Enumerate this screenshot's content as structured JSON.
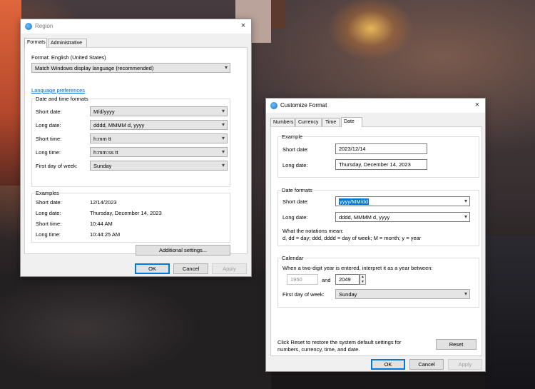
{
  "region": {
    "title": "Region",
    "close": "×",
    "tabs": [
      "Formats",
      "Administrative"
    ],
    "format_label": "Format: English (United States)",
    "format_value": "Match Windows display language (recommended)",
    "language_link": "Language preferences",
    "dt_group": "Date and time formats",
    "short_date": {
      "label": "Short date:",
      "value": "M/d/yyyy"
    },
    "long_date": {
      "label": "Long date:",
      "value": "dddd, MMMM d, yyyy"
    },
    "short_time": {
      "label": "Short time:",
      "value": "h:mm tt"
    },
    "long_time": {
      "label": "Long time:",
      "value": "h:mm:ss tt"
    },
    "first_day": {
      "label": "First day of week:",
      "value": "Sunday"
    },
    "examples_group": "Examples",
    "examples": [
      {
        "label": "Short date:",
        "value": "12/14/2023"
      },
      {
        "label": "Long date:",
        "value": "Thursday, December 14, 2023"
      },
      {
        "label": "Short time:",
        "value": "10:44 AM"
      },
      {
        "label": "Long time:",
        "value": "10:44:25 AM"
      }
    ],
    "additional_btn": "Additional settings...",
    "ok": "OK",
    "cancel": "Cancel",
    "apply": "Apply"
  },
  "customize": {
    "title": "Customize Format",
    "close": "×",
    "tabs": [
      "Numbers",
      "Currency",
      "Time",
      "Date"
    ],
    "example_group": "Example",
    "ex_short_label": "Short date:",
    "ex_short_value": "2023/12/14",
    "ex_long_label": "Long date:",
    "ex_long_value": "Thursday, December 14, 2023",
    "formats_group": "Date formats",
    "short_label": "Short date:",
    "short_value": "yyyy/MM/dd",
    "long_label": "Long date:",
    "long_value": "dddd, MMMM d, yyyy",
    "notations_title": "What the notations mean:",
    "notations_text": "d, dd = day;  ddd, dddd = day of week;  M = month;  y = year",
    "calendar_group": "Calendar",
    "calendar_text": "When a two-digit year is entered, interpret it as a year between:",
    "year_from": "1950",
    "and": "and",
    "year_to": "2049",
    "first_day_label": "First day of week:",
    "first_day_value": "Sunday",
    "reset_text_1": "Click Reset to restore the system default settings for",
    "reset_text_2": "numbers, currency, time, and date.",
    "reset": "Reset",
    "ok": "OK",
    "cancel": "Cancel",
    "apply": "Apply"
  },
  "icons": {
    "dropdown": "▾",
    "spin_up": "▲",
    "spin_down": "▼"
  }
}
